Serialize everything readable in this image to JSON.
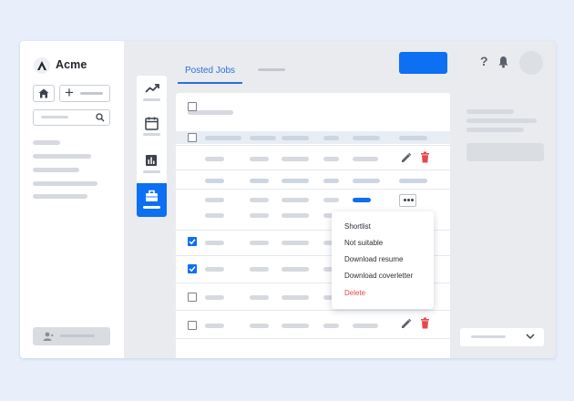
{
  "app": {
    "name": "Acme"
  },
  "tabs": [
    {
      "label": "Posted Jobs",
      "active": true
    }
  ],
  "menu": {
    "items": [
      {
        "label": "Shortlist",
        "danger": false
      },
      {
        "label": "Not suitable",
        "danger": false
      },
      {
        "label": "Download resume",
        "danger": false
      },
      {
        "label": "Download coverletter",
        "danger": false
      },
      {
        "label": "Delete",
        "danger": true
      }
    ]
  },
  "header_actions": {
    "help_glyph": "?"
  },
  "table": {
    "rows": [
      {
        "checked": false,
        "actions": "edit-delete"
      },
      {
        "checked": null,
        "actions": "none"
      },
      {
        "checked": null,
        "actions": "more",
        "status": "active"
      },
      {
        "checked": true,
        "actions": "hidden"
      },
      {
        "checked": true,
        "actions": "hidden"
      },
      {
        "checked": false,
        "actions": "hidden"
      },
      {
        "checked": false,
        "actions": "edit-delete"
      }
    ]
  },
  "colors": {
    "accent": "#0d6ff2",
    "danger": "#e5484d",
    "page_background": "#e8eefa"
  },
  "icons": [
    "logo-icon",
    "home-icon",
    "plus-icon",
    "search-icon",
    "user-icon",
    "trend-icon",
    "calendar-icon",
    "bar-chart-icon",
    "briefcase-icon",
    "pencil-icon",
    "trash-icon",
    "more-icon",
    "help-icon",
    "bell-icon",
    "chevron-down-icon"
  ]
}
